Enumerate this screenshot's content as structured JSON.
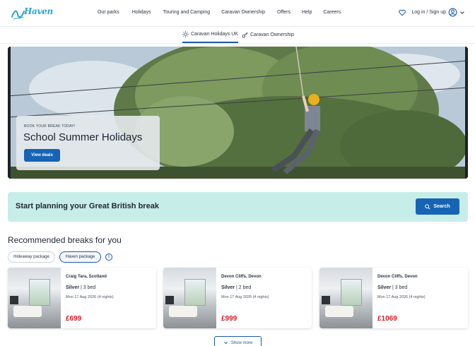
{
  "header": {
    "logo_text": "Haven",
    "nav": [
      "Our parks",
      "Holidays",
      "Touring and Camping",
      "Caravan Ownership",
      "Offers",
      "Help",
      "Careers"
    ],
    "login_label": "Log in / Sign up"
  },
  "subnav": {
    "tabs": [
      {
        "label": "Caravan Holidays UK",
        "icon": "sun-icon",
        "active": true
      },
      {
        "label": "Caravan Ownership",
        "icon": "key-icon",
        "active": false
      }
    ]
  },
  "hero": {
    "eyebrow": "BOOK YOUR BREAK TODAY!",
    "title": "School Summer Holidays",
    "cta": "View deals"
  },
  "planning": {
    "title": "Start planning your Great British break",
    "search_label": "Search"
  },
  "recommended": {
    "title": "Recommended breaks for you",
    "chips": [
      {
        "label": "Hideaway package",
        "active": false
      },
      {
        "label": "Haven package",
        "active": true
      }
    ],
    "cards": [
      {
        "location": "Craig Tara, Scotland",
        "grade": "Silver",
        "beds": "3 bed",
        "date": "Mon 17 Aug 2026 (4 nights)",
        "price": "£699"
      },
      {
        "location": "Devon Cliffs, Devon",
        "grade": "Silver",
        "beds": "2 bed",
        "date": "Mon 17 Aug 2026 (4 nights)",
        "price": "£999"
      },
      {
        "location": "Devon Cliffs, Devon",
        "grade": "Silver",
        "beds": "3 bed",
        "date": "Mon 17 Aug 2026 (4 nights)",
        "price": "£1069"
      }
    ],
    "show_more": "Show more"
  },
  "colors": {
    "primary": "#1664b3",
    "price": "#d32027",
    "plan_bg": "#c7ede9",
    "logo": "#2aa3d8"
  }
}
